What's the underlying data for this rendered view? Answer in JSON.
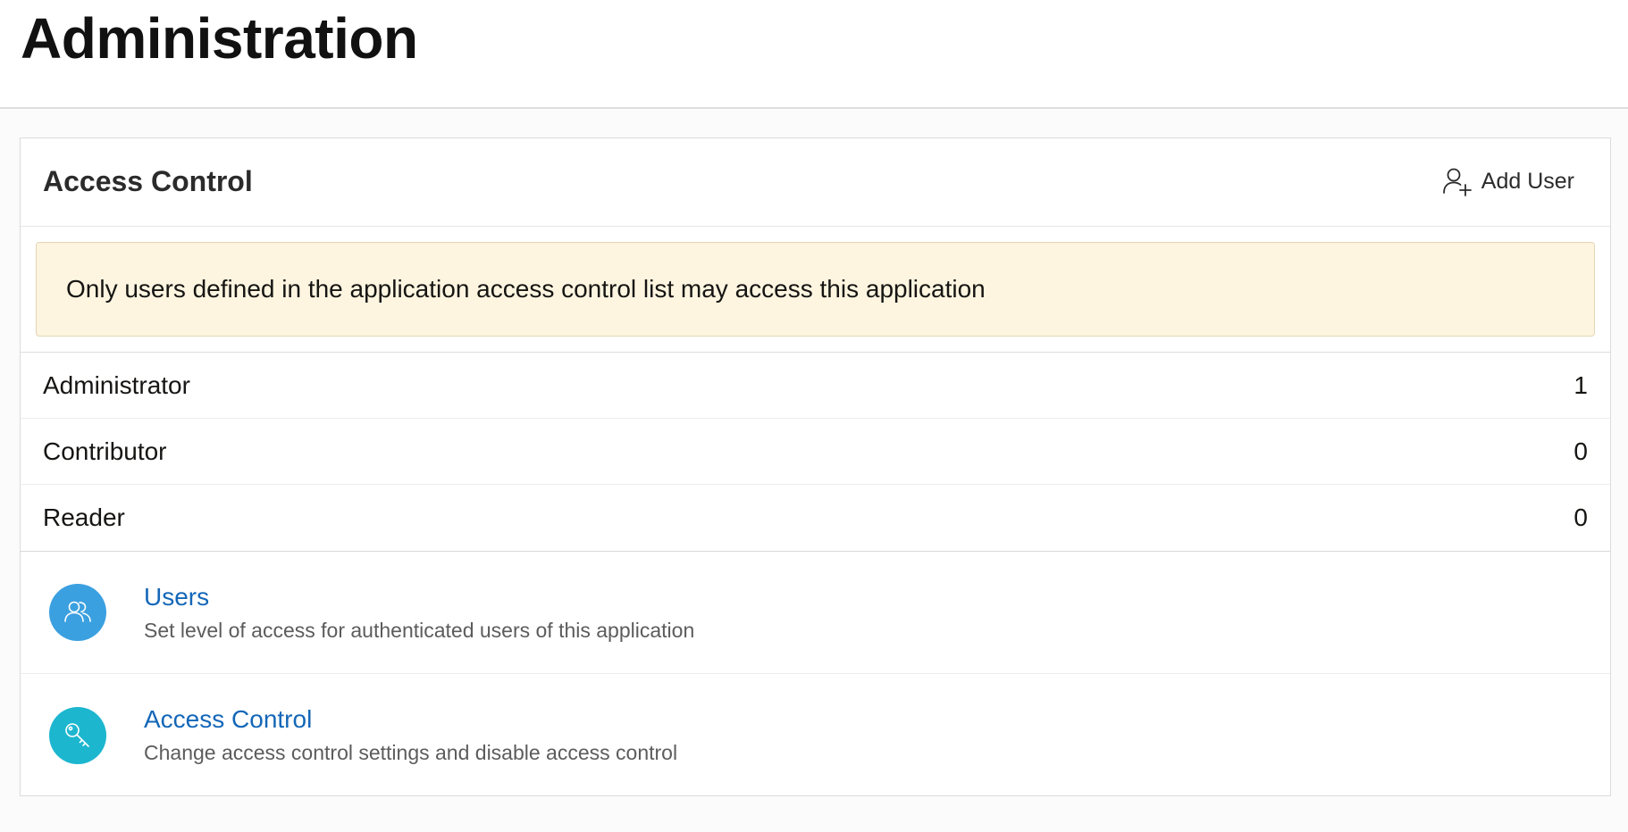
{
  "page": {
    "title": "Administration"
  },
  "region": {
    "title": "Access Control",
    "add_user_label": "Add User",
    "add_user_icon": "user-add-icon"
  },
  "alert": {
    "message": "Only users defined in the application access control list may access this application"
  },
  "roles": [
    {
      "name": "Administrator",
      "count": "1"
    },
    {
      "name": "Contributor",
      "count": "0"
    },
    {
      "name": "Reader",
      "count": "0"
    }
  ],
  "links": [
    {
      "title": "Users",
      "description": "Set level of access for authenticated users of this application",
      "icon": "users-icon",
      "icon_color": "#3ba0e0"
    },
    {
      "title": "Access Control",
      "description": "Change access control settings and disable access control",
      "icon": "key-icon",
      "icon_color": "#1cb6cf"
    }
  ],
  "colors": {
    "link": "#1467b8",
    "alert_background": "#fdf5e0"
  }
}
